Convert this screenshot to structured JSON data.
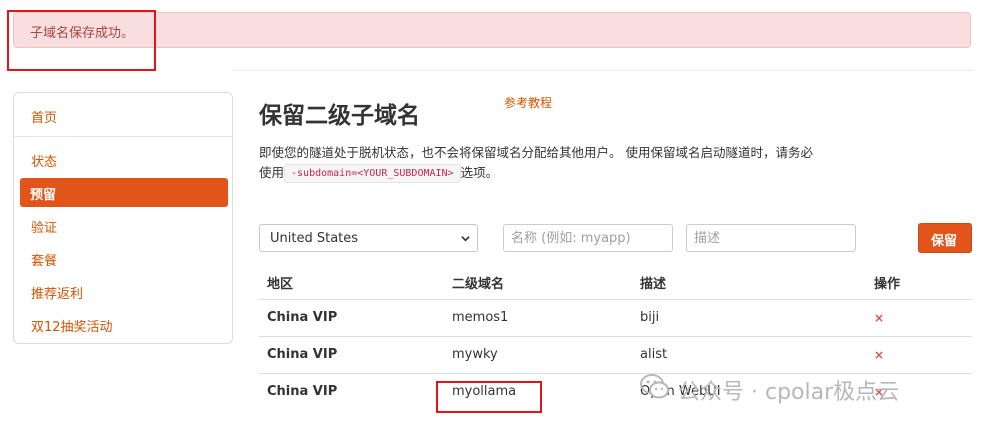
{
  "alert": {
    "message": "子域名保存成功。"
  },
  "sidebar": {
    "items": [
      {
        "label": "首页"
      },
      {
        "label": "状态"
      },
      {
        "label": "预留"
      },
      {
        "label": "验证"
      },
      {
        "label": "套餐"
      },
      {
        "label": "推荐返利"
      },
      {
        "label": "双12抽奖活动"
      }
    ]
  },
  "main": {
    "title": "保留二级子域名",
    "ref_link": "参考教程",
    "description_part1": "即使您的隧道处于脱机状态，也不会将保留域名分配给其他用户。 使用保留域名启动隧道时，请务必使用",
    "description_code": "-subdomain=<YOUR_SUBDOMAIN>",
    "description_part2": "选项。"
  },
  "form": {
    "region_selected": "United States",
    "name_placeholder": "名称 (例如: myapp)",
    "desc_placeholder": "描述",
    "save_label": "保留"
  },
  "table": {
    "headers": {
      "region": "地区",
      "subdomain": "二级域名",
      "description": "描述",
      "action": "操作"
    },
    "rows": [
      {
        "region": "China VIP",
        "subdomain": "memos1",
        "description": "biji",
        "action": "×"
      },
      {
        "region": "China VIP",
        "subdomain": "mywky",
        "description": "alist",
        "action": "×"
      },
      {
        "region": "China VIP",
        "subdomain": "myollama",
        "description": "Open WebUI",
        "action": "×"
      }
    ]
  },
  "watermark": {
    "text": "公众号 · cpolar极点云"
  },
  "colors": {
    "accent": "#e1551b",
    "link": "#d35400",
    "alert_bg": "#f8dede",
    "alert_text": "#a94442",
    "highlight": "#e0141b"
  }
}
